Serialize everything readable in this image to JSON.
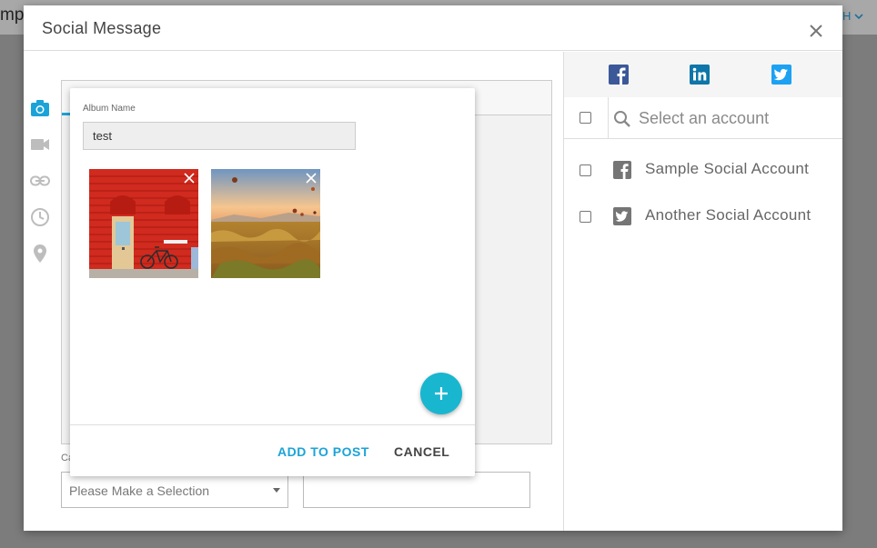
{
  "background": {
    "left_text": "mp",
    "right_text": "H"
  },
  "dialog": {
    "title": "Social Message"
  },
  "editor": {
    "category_label": "Ca",
    "category_select": {
      "selected": "Please Make a Selection"
    }
  },
  "album": {
    "name_label": "Album Name",
    "name_value": "test",
    "add_button": "ADD TO POST",
    "cancel_button": "CANCEL"
  },
  "accounts_panel": {
    "search_placeholder": "Select an account",
    "accounts": [
      {
        "label": "Sample Social Account",
        "icon": "facebook-icon"
      },
      {
        "label": "Another Social Account",
        "icon": "twitter-icon"
      }
    ]
  },
  "colors": {
    "accent": "#1ba3d8",
    "fab": "#19b6cf",
    "facebook": "#3b5998",
    "linkedin": "#0e76a8",
    "twitter": "#1da1f2"
  }
}
